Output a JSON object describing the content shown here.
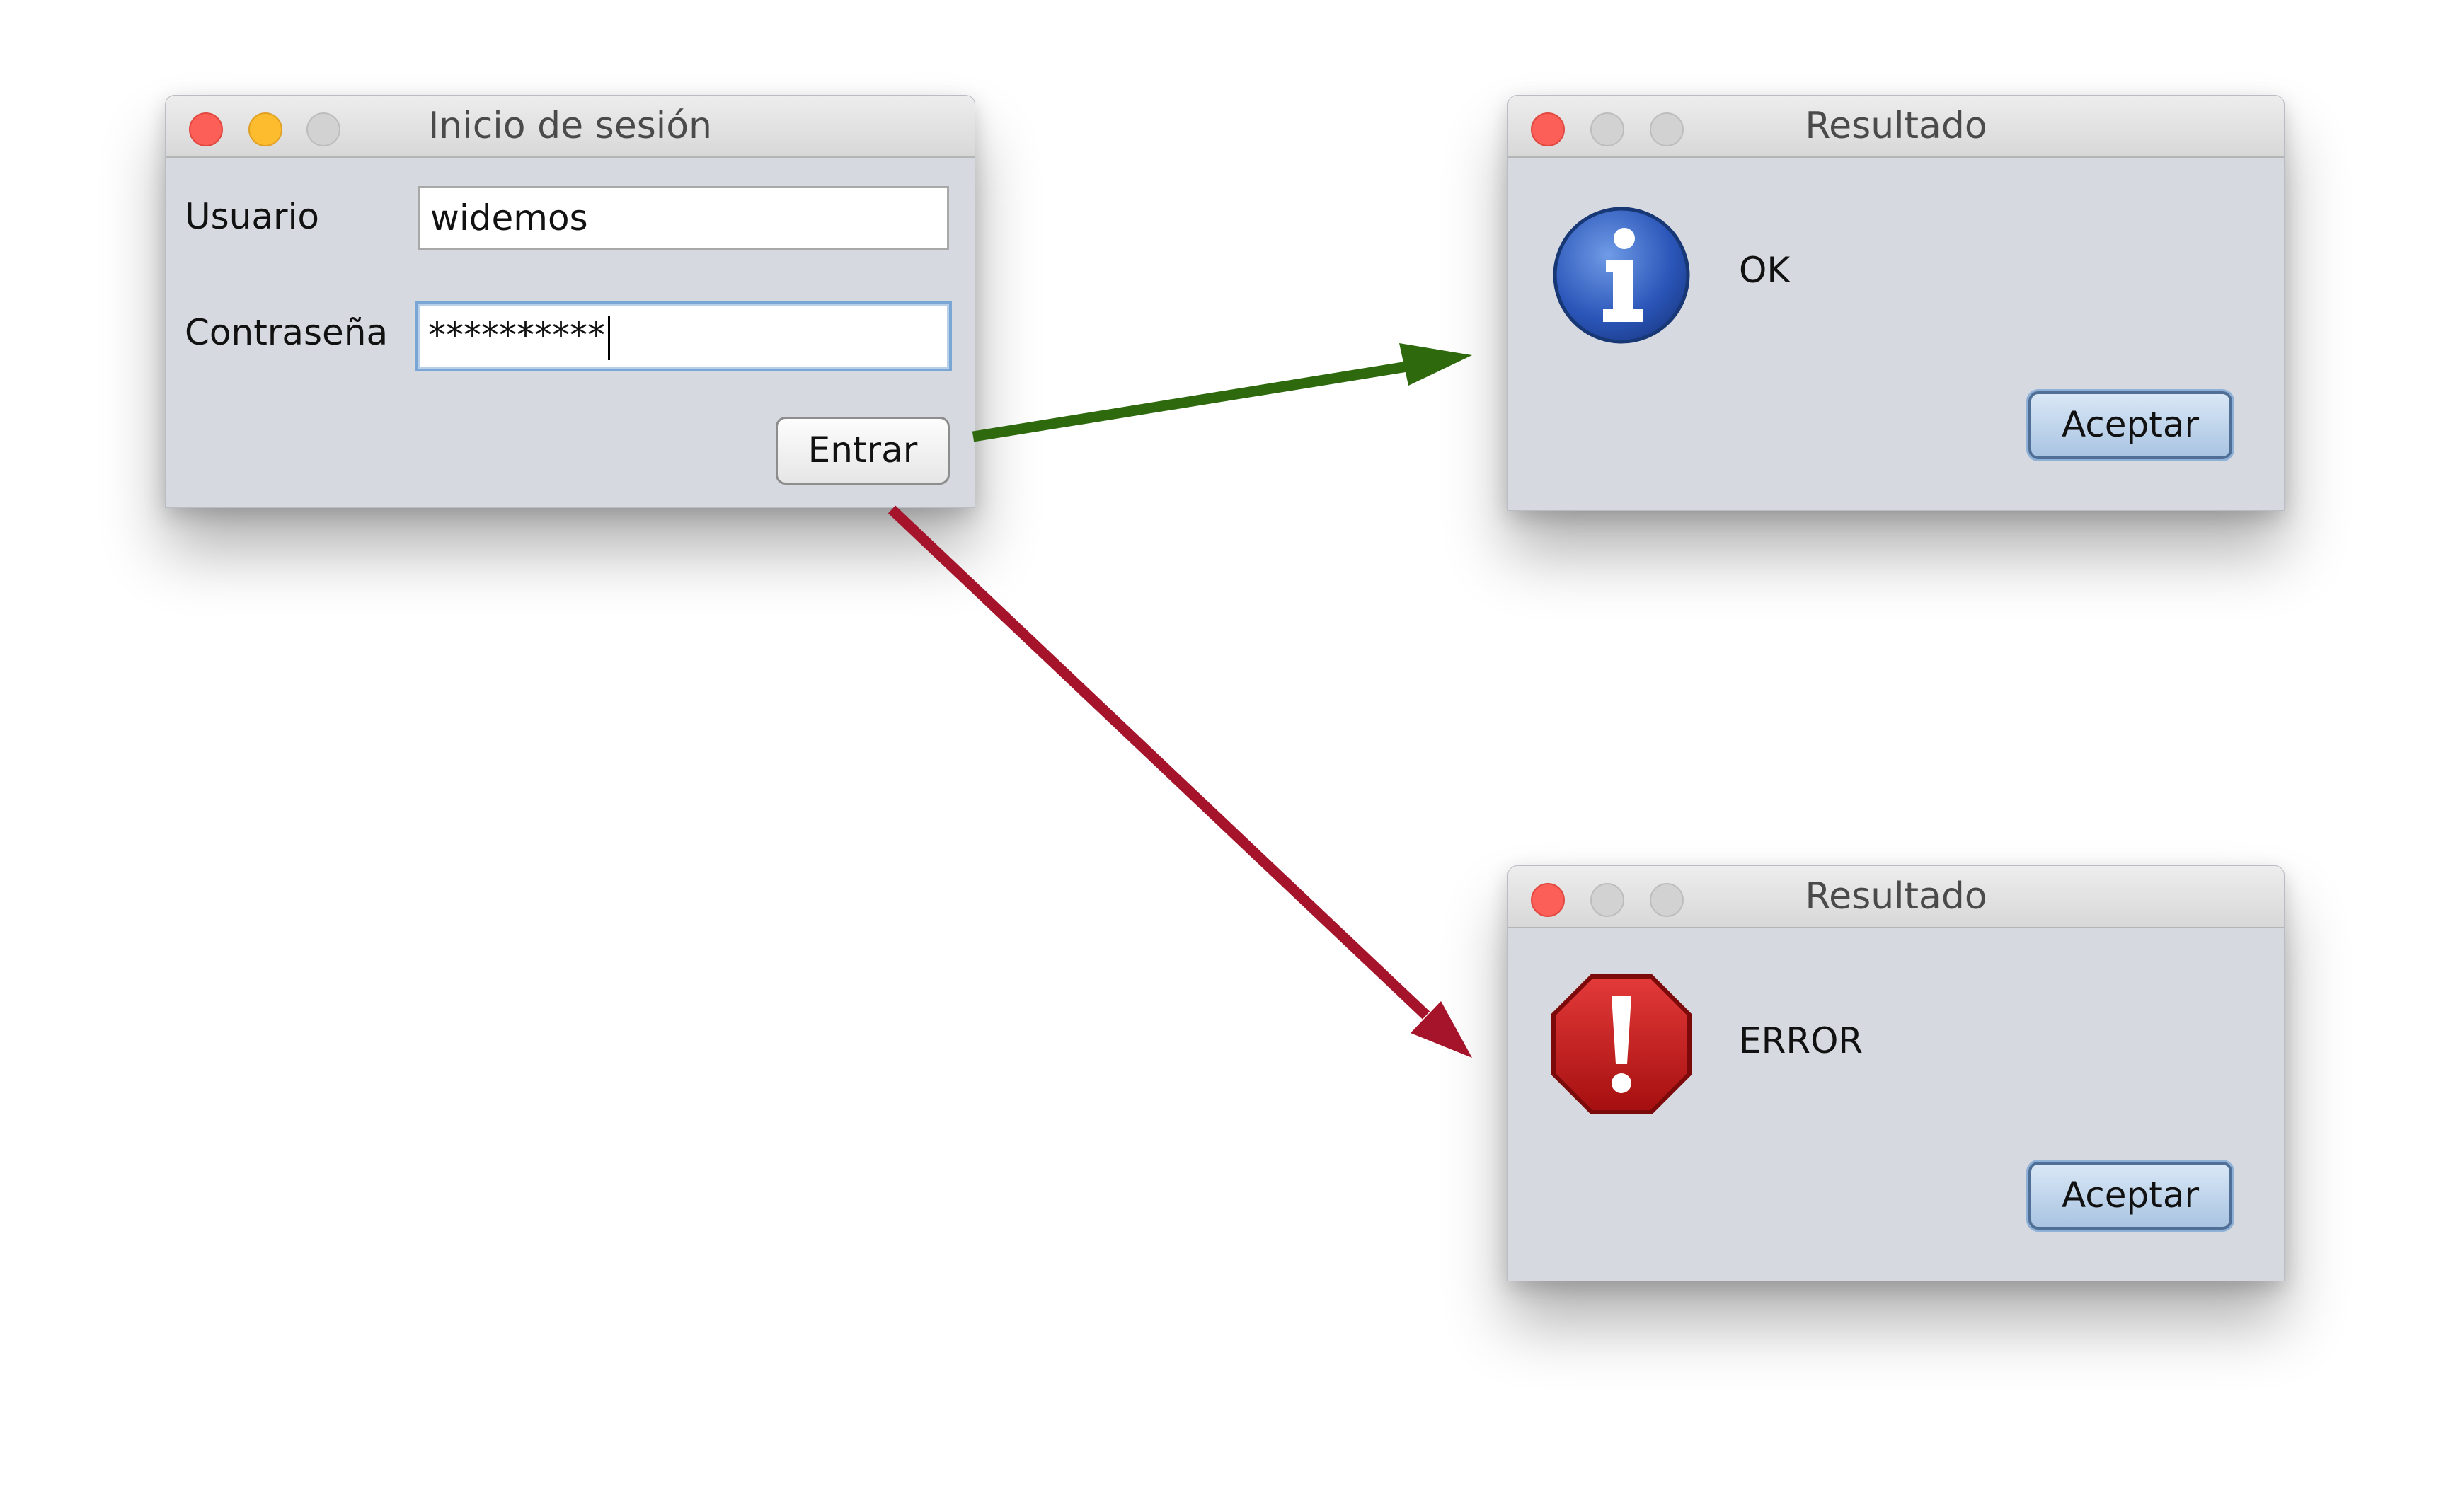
{
  "login_window": {
    "title": "Inicio de sesión",
    "user_label": "Usuario",
    "user_value": "widemos",
    "password_label": "Contraseña",
    "password_value": "**********",
    "submit_label": "Entrar"
  },
  "success_dialog": {
    "title": "Resultado",
    "message": "OK",
    "icon": "info-icon",
    "button_label": "Aceptar"
  },
  "error_dialog": {
    "title": "Resultado",
    "message": "ERROR",
    "icon": "error-icon",
    "button_label": "Aceptar"
  },
  "colors": {
    "success_arrow": "#2e6a0d",
    "error_arrow": "#a6142b",
    "info_blue": "#2a55b8",
    "error_red": "#c41b1b"
  }
}
